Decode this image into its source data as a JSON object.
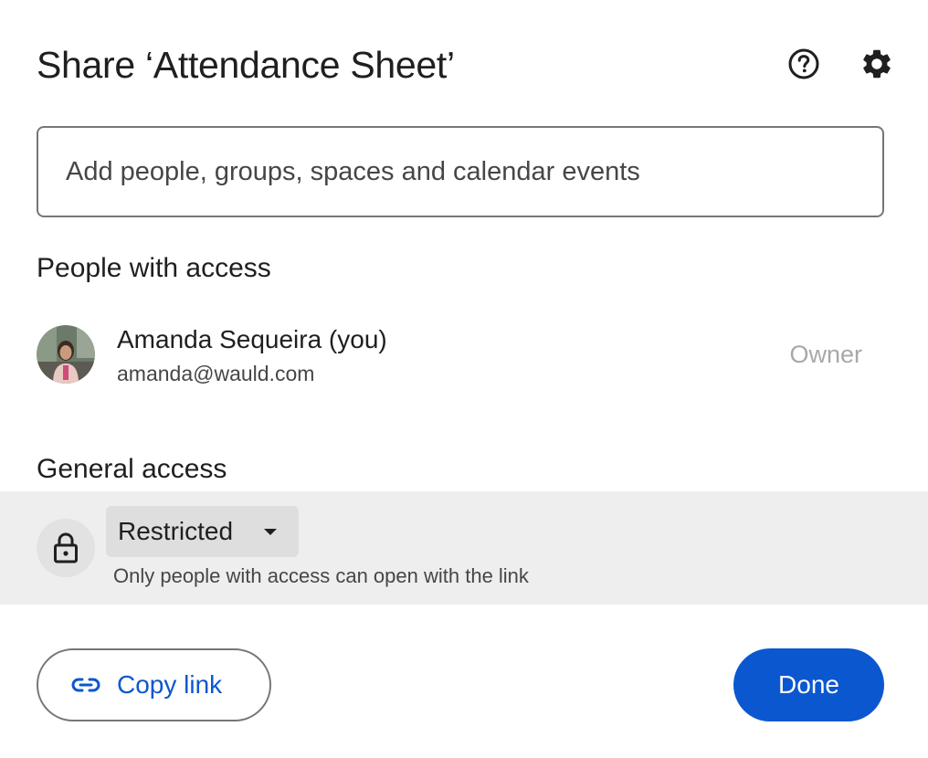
{
  "dialog": {
    "title": "Share ‘Attendance Sheet’",
    "help_icon": "help-circle-icon",
    "settings_icon": "gear-icon"
  },
  "search": {
    "placeholder": "Add people, groups, spaces and calendar events",
    "value": ""
  },
  "people_section": {
    "heading": "People with access",
    "people": [
      {
        "name": "Amanda Sequeira (you)",
        "email": "amanda@wauld.com",
        "role": "Owner"
      }
    ]
  },
  "general_access": {
    "heading": "General access",
    "lock_icon": "lock-icon",
    "selected": "Restricted",
    "description": "Only people with access can open with the link"
  },
  "footer": {
    "copy_link_label": "Copy link",
    "copy_link_icon": "link-icon",
    "done_label": "Done"
  },
  "colors": {
    "accent": "#0b57d0",
    "text_primary": "#1f1f1f",
    "text_secondary": "#444746",
    "role_text": "#a8a8a8",
    "access_row_bg": "#eeeeee",
    "border": "#747775"
  }
}
